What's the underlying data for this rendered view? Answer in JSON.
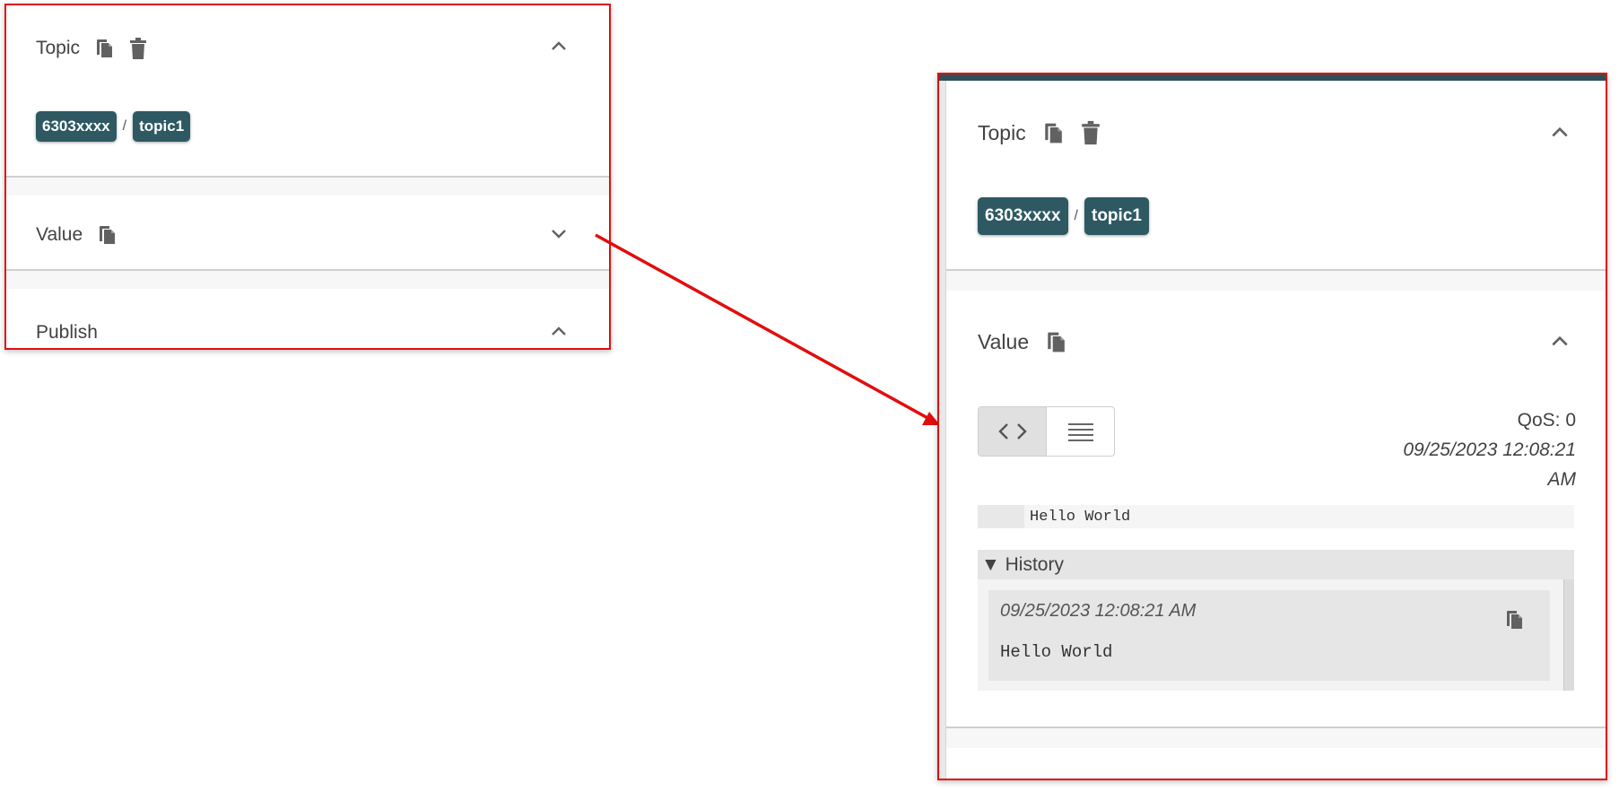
{
  "left_panel": {
    "topic_section": {
      "title": "Topic",
      "copy_icon": "copy-icon",
      "delete_icon": "trash-icon",
      "chevron": "chevron-up-icon",
      "breadcrumb": [
        "6303xxxx",
        "topic1"
      ],
      "separator": "/"
    },
    "value_section": {
      "title": "Value",
      "copy_icon": "copy-icon",
      "chevron": "chevron-down-icon"
    },
    "publish_section": {
      "title": "Publish",
      "chevron": "chevron-up-icon"
    }
  },
  "right_panel": {
    "topic_section": {
      "title": "Topic",
      "copy_icon": "copy-icon",
      "delete_icon": "trash-icon",
      "chevron": "chevron-up-icon",
      "breadcrumb": [
        "6303xxxx",
        "topic1"
      ],
      "separator": "/"
    },
    "value_section": {
      "title": "Value",
      "copy_icon": "copy-icon",
      "chevron": "chevron-up-icon",
      "view_toggle": {
        "options": [
          "code-view-icon",
          "text-view-icon"
        ],
        "selected": "code-view-icon"
      },
      "qos": "QoS: 0",
      "timestamp_line1": "09/25/2023 12:08:21",
      "timestamp_line2": "AM",
      "value_text": "Hello World",
      "history": {
        "header": "▼ History",
        "items": [
          {
            "timestamp": "09/25/2023 12:08:21 AM",
            "value": "Hello World",
            "copy_icon": "copy-icon"
          }
        ]
      }
    }
  },
  "annotation": {
    "arrow_color": "#e10e0e",
    "highlight_border_color": "#e10e0e"
  },
  "colors": {
    "chip_background": "#2e5963",
    "topbar": "#2e4f59"
  }
}
